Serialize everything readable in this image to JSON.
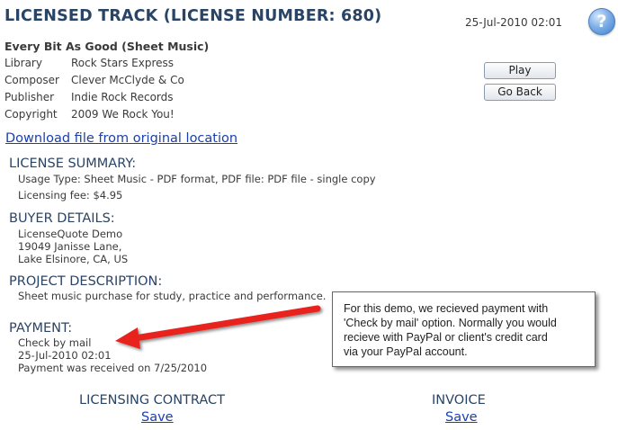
{
  "page": {
    "title": "LICENSED TRACK (LICENSE NUMBER: 680)",
    "timestamp": "25-Jul-2010 02:01",
    "help_glyph": "?"
  },
  "track": {
    "title": "Every Bit As Good (Sheet Music)",
    "meta": [
      {
        "label": "Library",
        "value": "Rock Stars Express"
      },
      {
        "label": "Composer",
        "value": "Clever McClyde & Co"
      },
      {
        "label": "Publisher",
        "value": "Indie Rock Records"
      },
      {
        "label": "Copyright",
        "value": "2009 We Rock You!"
      }
    ]
  },
  "buttons": {
    "play": "Play",
    "go_back": "Go Back"
  },
  "download_link": "Download file from original location",
  "license_summary": {
    "heading": "LICENSE SUMMARY:",
    "usage": "Usage Type: Sheet Music - PDF format, PDF file: PDF file - single copy",
    "fee": "Licensing fee: $4.95"
  },
  "buyer": {
    "heading": "BUYER DETAILS:",
    "name": "LicenseQuote Demo",
    "street": "19049 Janisse Lane,",
    "city": "Lake Elsinore, CA, US"
  },
  "project": {
    "heading": "PROJECT DESCRIPTION:",
    "description": "Sheet music purchase for study, practice and performance."
  },
  "payment": {
    "heading": "PAYMENT:",
    "method": "Check by mail",
    "date": "25-Jul-2010 02:01",
    "received": "Payment was received on 7/25/2010"
  },
  "callout": {
    "lines": [
      "For this demo, we recieved payment with",
      "'Check by mail' option. Normally you would",
      "recieve with PayPal or client's credit card",
      "via your PayPal account."
    ],
    "arrow_color": "#e8231c"
  },
  "footer": {
    "contract_heading": "LICENSING CONTRACT",
    "contract_save": "Save",
    "invoice_heading": "INVOICE",
    "invoice_save": "Save"
  }
}
